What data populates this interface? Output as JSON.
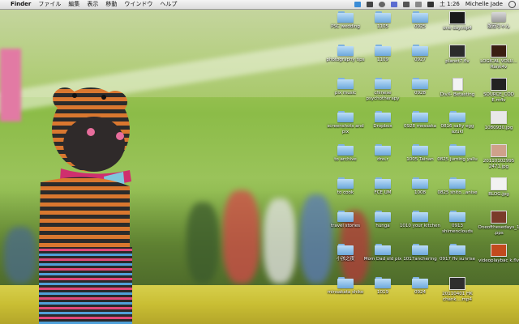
{
  "menubar": {
    "apple_symbol": "",
    "app_name": "Finder",
    "menus": [
      "ファイル",
      "編集",
      "表示",
      "移動",
      "ウインドウ",
      "ヘルプ"
    ],
    "clock": "土 1:26",
    "user": "Michelle Jade"
  },
  "desktop_icons": [
    {
      "label": "PSC wedding",
      "kind": "folder"
    },
    {
      "label": "1105",
      "kind": "folder"
    },
    {
      "label": "0925",
      "kind": "folder"
    },
    {
      "label": "one day.mp4",
      "kind": "video",
      "color": "#1a1a1a"
    },
    {
      "label": "腹筋ちゃん",
      "kind": "disk"
    },
    {
      "label": "photography tips",
      "kind": "folder"
    },
    {
      "label": "1109",
      "kind": "folder"
    },
    {
      "label": "0927",
      "kind": "folder"
    },
    {
      "label": "planet7.flv",
      "kind": "video",
      "color": "#2b2b2b"
    },
    {
      "label": "LOGICAL VOLU... Rank4v",
      "kind": "video",
      "color": "#3a1f12"
    },
    {
      "label": "pix music",
      "kind": "folder"
    },
    {
      "label": "chinese psychotherapy",
      "kind": "folder"
    },
    {
      "label": "0928",
      "kind": "folder"
    },
    {
      "label": "DivX- Betasting",
      "kind": "doc"
    },
    {
      "label": "SOURCE_COD E.m4v",
      "kind": "video",
      "color": "#222222"
    },
    {
      "label": "screenshots and pix",
      "kind": "folder"
    },
    {
      "label": "Dropbox",
      "kind": "folder"
    },
    {
      "label": "0928 messaka",
      "kind": "folder"
    },
    {
      "label": "0816 salty egg azuki",
      "kind": "folder"
    },
    {
      "label": "1080930.jpg",
      "kind": "image",
      "color": "#e8e8e8"
    },
    {
      "label": "to archive",
      "kind": "folder"
    },
    {
      "label": "dns.r",
      "kind": "folder"
    },
    {
      "label": "1005 Tainan",
      "kind": "folder"
    },
    {
      "label": "0825 juming yallu",
      "kind": "folder"
    },
    {
      "label": "20110102995 2471.jpg",
      "kind": "image",
      "color": "#cfa18a"
    },
    {
      "label": "to cook",
      "kind": "folder"
    },
    {
      "label": "FCE UM",
      "kind": "folder"
    },
    {
      "label": "1008",
      "kind": "folder"
    },
    {
      "label": "0825 shito...anise",
      "kind": "folder"
    },
    {
      "label": "BLOG.jpg",
      "kind": "image",
      "color": "#f2f2f2"
    },
    {
      "label": "travel stories",
      "kind": "folder"
    },
    {
      "label": "hunga",
      "kind": "folder"
    },
    {
      "label": "1010 your kitchen",
      "kind": "folder"
    },
    {
      "label": "0913 shimenclouds",
      "kind": "folder"
    },
    {
      "label": "Oneofthesedays_1.pps",
      "kind": "image",
      "color": "#7a3b2a"
    },
    {
      "label": "小孩之夜",
      "kind": "folder"
    },
    {
      "label": "Mom Dad old pix",
      "kind": "folder"
    },
    {
      "label": "1017anchering",
      "kind": "folder"
    },
    {
      "label": "0917 flv sunrise",
      "kind": "folder"
    },
    {
      "label": "videoplaybac k.flv",
      "kind": "image",
      "color": "#c24a1e"
    },
    {
      "label": "minsakata shiko",
      "kind": "folder"
    },
    {
      "label": "1019",
      "kind": "folder"
    },
    {
      "label": "0924",
      "kind": "folder"
    },
    {
      "label": "20110401 HK chank....mp4",
      "kind": "video",
      "color": "#2e2e2e"
    }
  ]
}
